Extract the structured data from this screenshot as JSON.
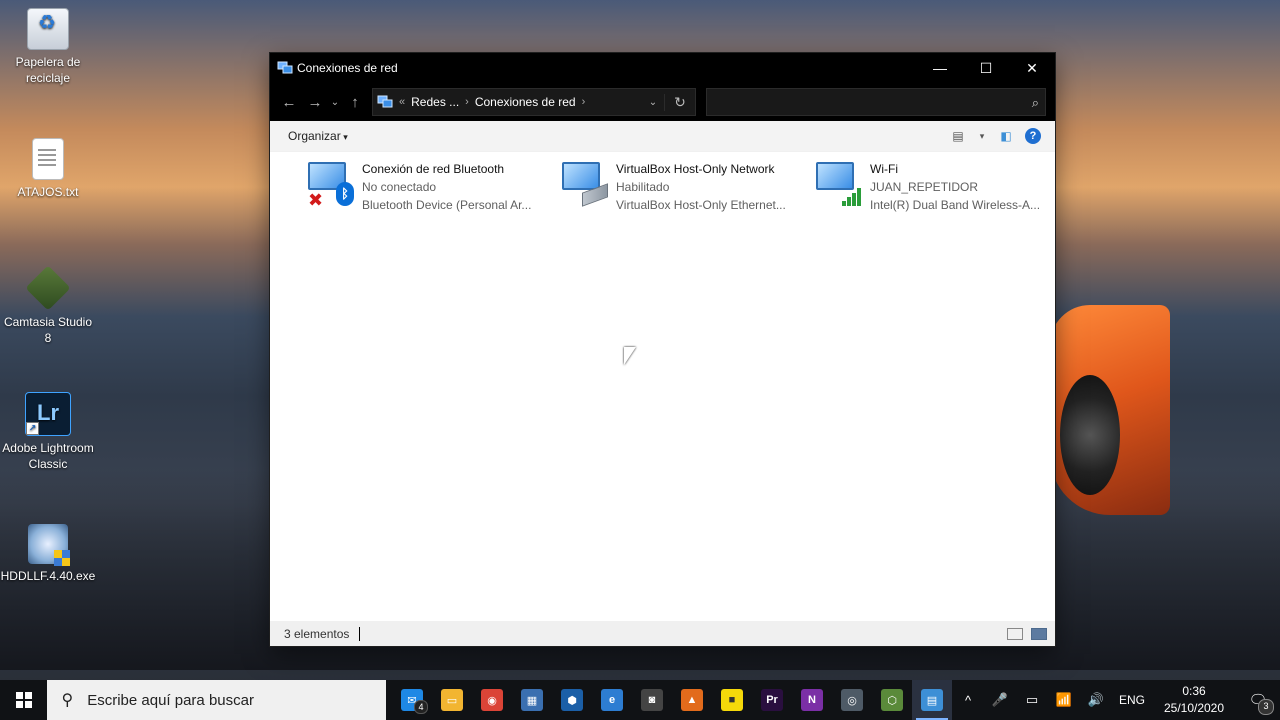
{
  "desktop": {
    "icons": [
      {
        "label": "Papelera de reciclaje"
      },
      {
        "label": "ATAJOS.txt"
      },
      {
        "label": "Camtasia Studio 8"
      },
      {
        "label": "Adobe Lightroom Classic"
      },
      {
        "label": "HDDLLF.4.40.exe"
      }
    ]
  },
  "window": {
    "title": "Conexiones de red",
    "controls": {
      "minimize": "—",
      "maximize": "☐",
      "close": "✕"
    },
    "nav": {
      "back": "←",
      "forward": "→",
      "recent": "⌄",
      "up": "↑"
    },
    "address": {
      "overflow": "«",
      "crumbs": [
        "Redes ...",
        "Conexiones de red"
      ],
      "refresh": "↻"
    },
    "search": {
      "placeholder": "",
      "icon": "search-icon"
    },
    "toolbar": {
      "organize": "Organizar",
      "help": "?"
    },
    "items": [
      {
        "name": "Conexión de red Bluetooth",
        "status": "No conectado",
        "device": "Bluetooth Device (Personal Ar..."
      },
      {
        "name": "VirtualBox Host-Only Network",
        "status": "Habilitado",
        "device": "VirtualBox Host-Only Ethernet..."
      },
      {
        "name": "Wi-Fi",
        "status": "JUAN_REPETIDOR",
        "device": "Intel(R) Dual Band Wireless-A..."
      }
    ],
    "status": {
      "count": "3 elementos"
    }
  },
  "taskbar": {
    "search_placeholder": "Escribe aquí para buscar",
    "apps": [
      {
        "name": "mail",
        "label": "✉",
        "badge": "4",
        "color": "#1e88e5"
      },
      {
        "name": "explorer",
        "label": "▭",
        "color": "#f2b531"
      },
      {
        "name": "chrome",
        "label": "◉",
        "color": "#db4437"
      },
      {
        "name": "calculator",
        "label": "▦",
        "color": "#3a6fb0"
      },
      {
        "name": "virtualbox",
        "label": "⬢",
        "color": "#1b5fa7"
      },
      {
        "name": "browser",
        "label": "e",
        "color": "#2d7dd2"
      },
      {
        "name": "camera",
        "label": "◙",
        "color": "#444444"
      },
      {
        "name": "matlab",
        "label": "▲",
        "color": "#e26b1c"
      },
      {
        "name": "sticky-notes",
        "label": "■",
        "color": "#f5d90a"
      },
      {
        "name": "premiere",
        "label": "Pr",
        "color": "#2a0f3f"
      },
      {
        "name": "onenote",
        "label": "N",
        "color": "#7b2fa6"
      },
      {
        "name": "disk-tool",
        "label": "◎",
        "color": "#4e5a66"
      },
      {
        "name": "network-tool",
        "label": "⬡",
        "color": "#5a8a3a"
      },
      {
        "name": "control-panel",
        "label": "▤",
        "color": "#3d8fd6"
      }
    ],
    "tray": {
      "up": "^",
      "mic": "🎤",
      "battery": "▭",
      "wifi": "📶",
      "volume": "🔊",
      "lang": "ENG"
    },
    "clock": {
      "time": "0:36",
      "date": "25/10/2020"
    },
    "notifications": "3"
  }
}
